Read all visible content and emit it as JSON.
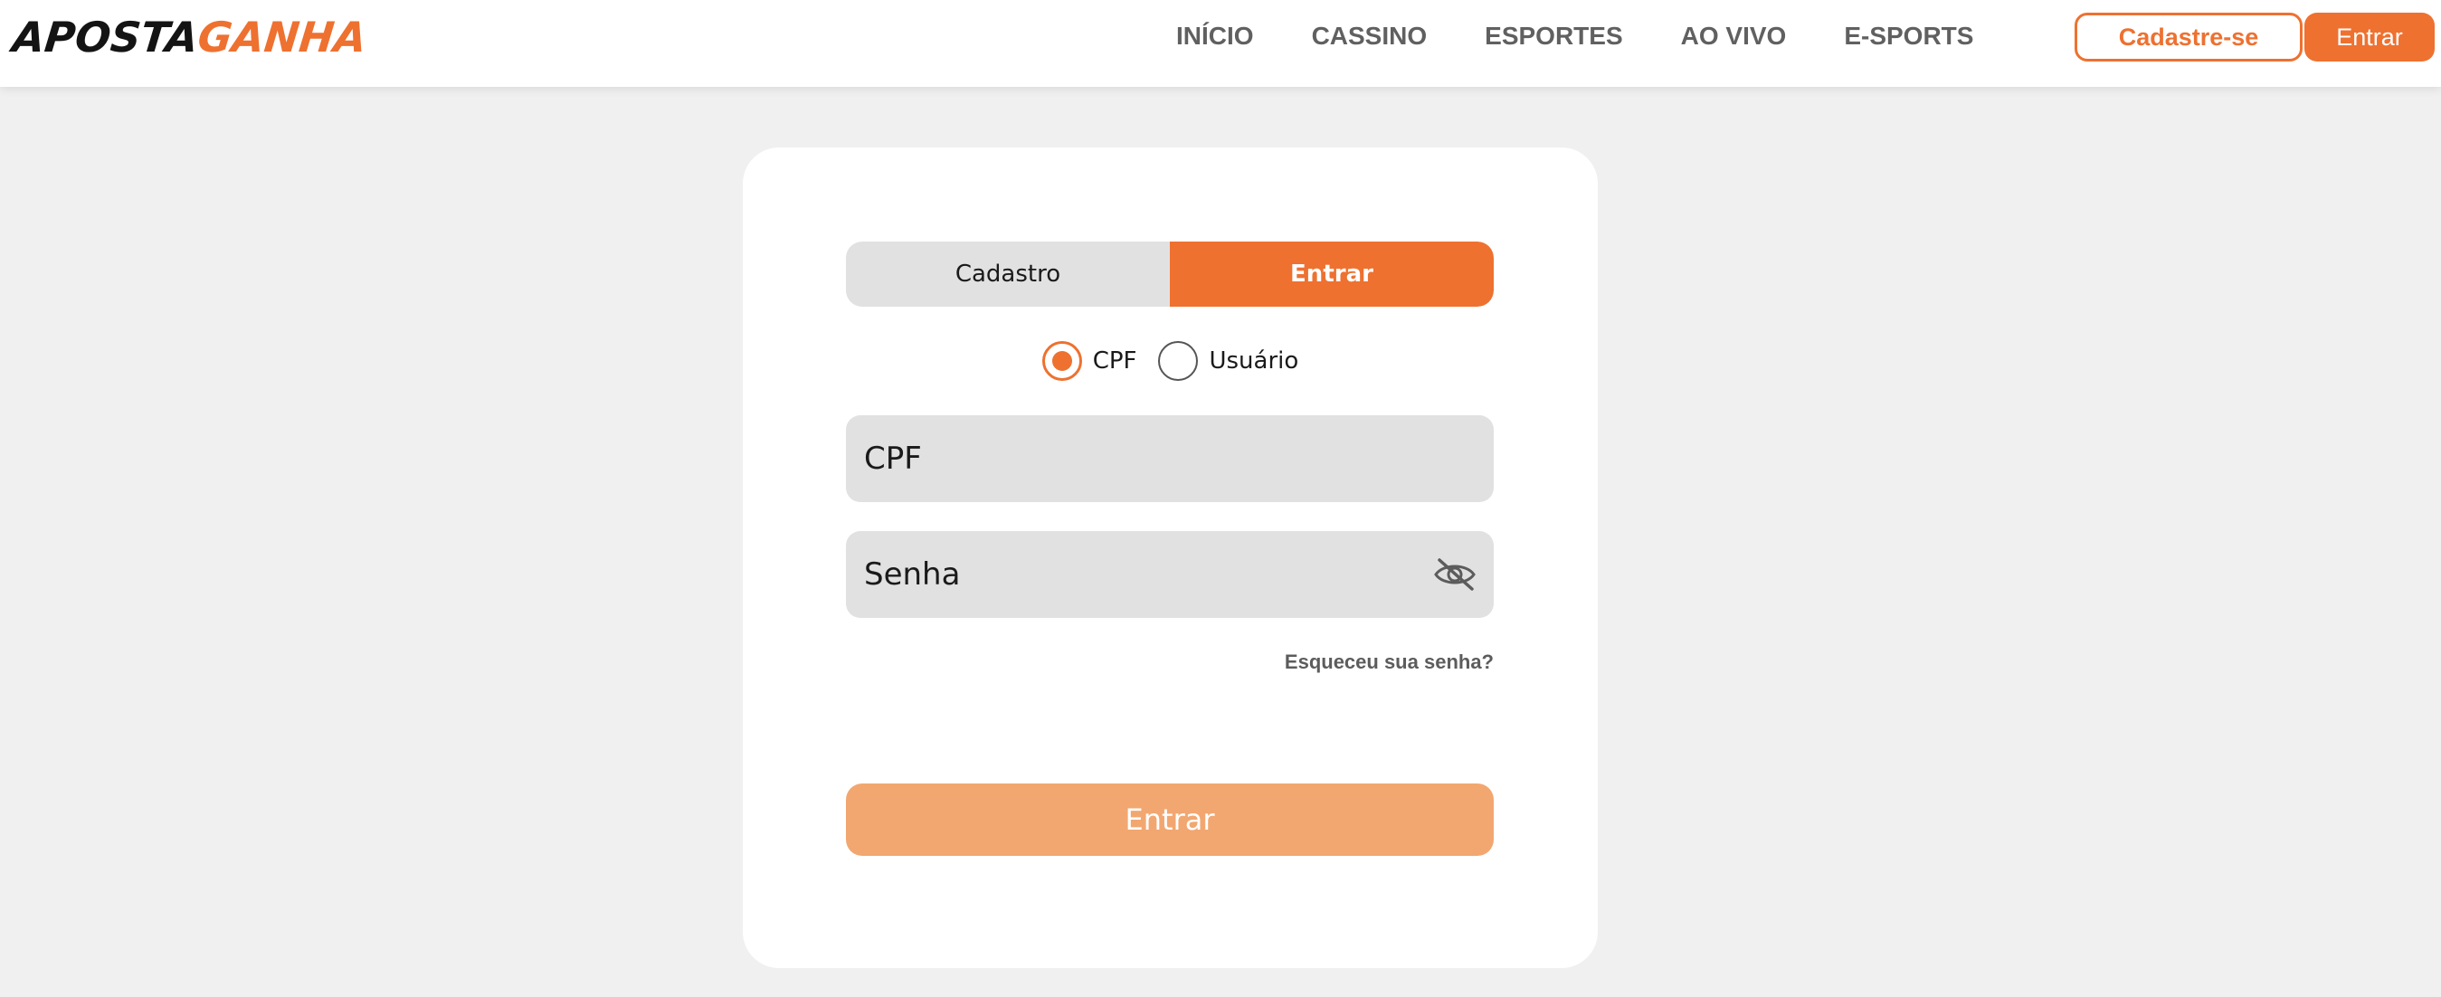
{
  "brand": {
    "logo_part1": "APOSTA",
    "logo_part2": "GANHA",
    "accent_color": "#ee7130",
    "dark_color": "#141414"
  },
  "nav": {
    "items": [
      "INÍCIO",
      "CASSINO",
      "ESPORTES",
      "AO VIVO",
      "E-SPORTS"
    ]
  },
  "header_buttons": {
    "signup": "Cadastre-se",
    "login": "Entrar"
  },
  "login_card": {
    "tabs": {
      "register": "Cadastro",
      "login": "Entrar",
      "active": "login"
    },
    "login_type": {
      "options": [
        "CPF",
        "Usuário"
      ],
      "selected": "CPF"
    },
    "cpf_field": {
      "placeholder": "CPF"
    },
    "password_field": {
      "placeholder": "Senha",
      "icon": "eye-slash-icon"
    },
    "forgot_password": "Esqueceu sua senha?",
    "submit": "Entrar"
  }
}
